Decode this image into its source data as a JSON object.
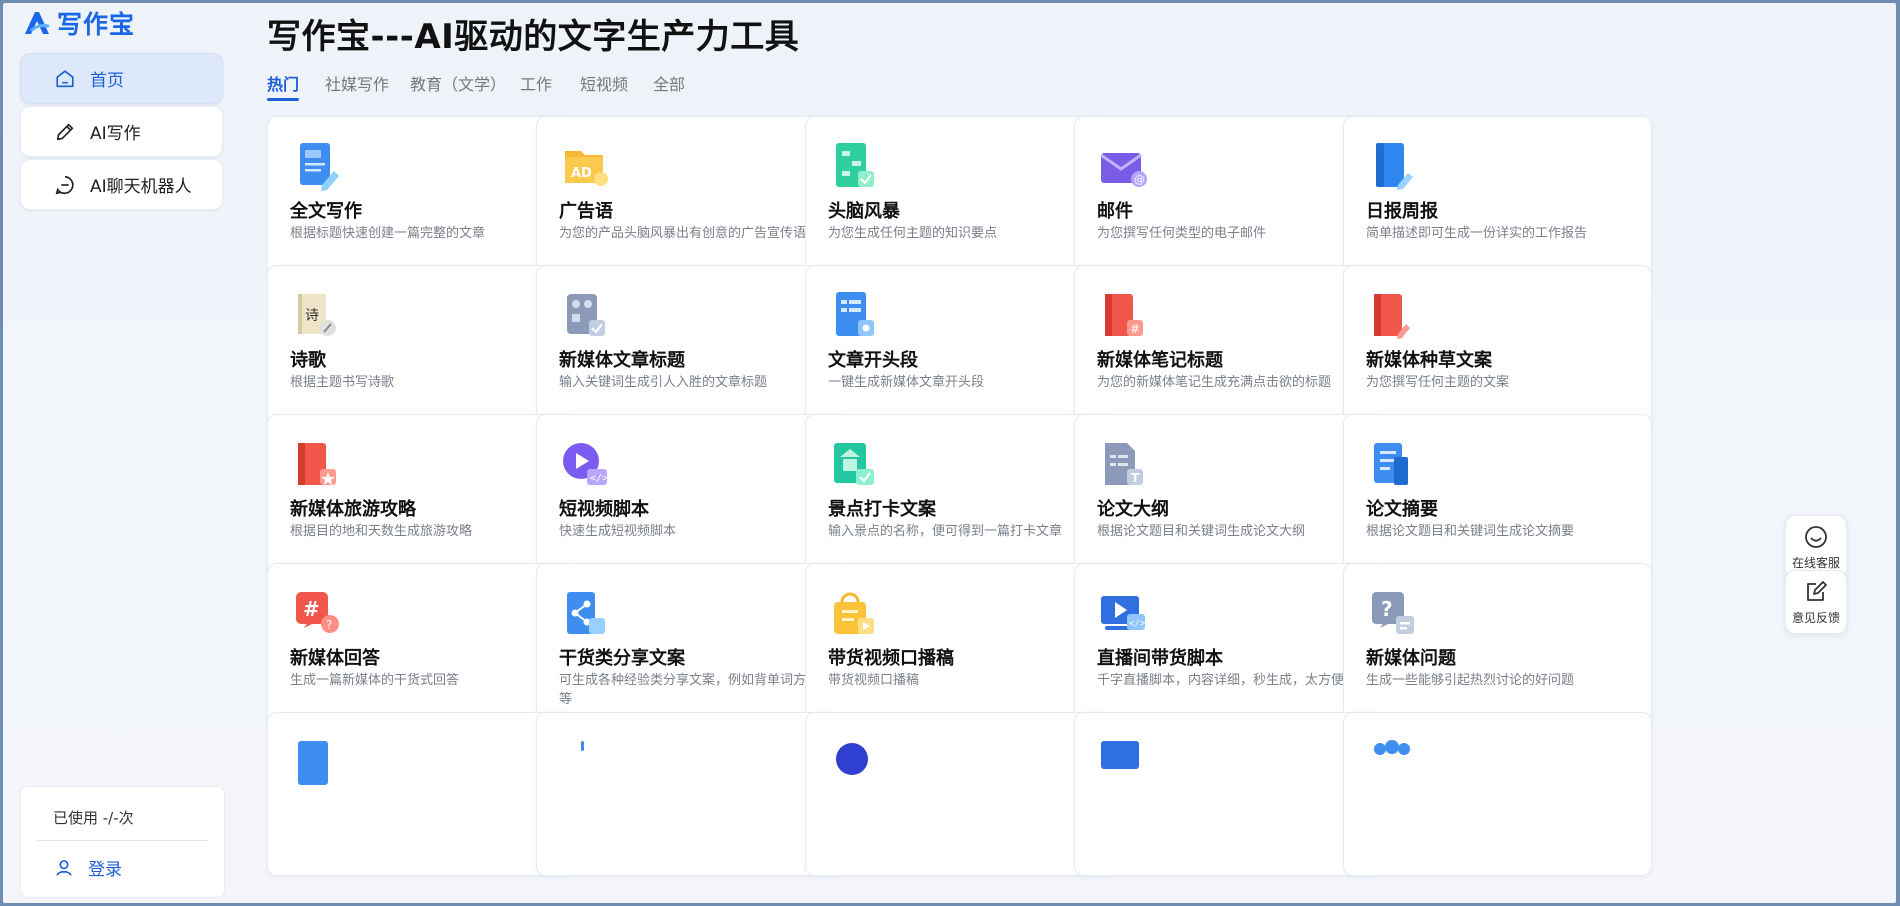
{
  "app": {
    "logo_text": "写作宝"
  },
  "sidebar": {
    "items": [
      {
        "label": "首页",
        "icon": "home-icon",
        "active": true
      },
      {
        "label": "AI写作",
        "icon": "pencil-icon",
        "active": false
      },
      {
        "label": "AI聊天机器人",
        "icon": "chat-icon",
        "active": false
      }
    ],
    "usage_text": "已使用 -/-次",
    "login_label": "登录"
  },
  "header": {
    "title": "写作宝---AI驱动的文字生产力工具"
  },
  "tabs": [
    {
      "label": "热门",
      "active": true
    },
    {
      "label": "社媒写作",
      "active": false
    },
    {
      "label": "教育（文学）",
      "active": false
    },
    {
      "label": "工作",
      "active": false
    },
    {
      "label": "短视频",
      "active": false
    },
    {
      "label": "全部",
      "active": false
    }
  ],
  "cards": [
    {
      "title": "全文写作",
      "desc": "根据标题快速创建一篇完整的文章",
      "icon": "document-write-icon"
    },
    {
      "title": "广告语",
      "desc": "为您的产品头脑风暴出有创意的广告宣传语",
      "icon": "ad-folder-icon"
    },
    {
      "title": "头脑风暴",
      "desc": "为您生成任何主题的知识要点",
      "icon": "mindmap-icon"
    },
    {
      "title": "邮件",
      "desc": "为您撰写任何类型的电子邮件",
      "icon": "email-icon"
    },
    {
      "title": "日报周报",
      "desc": "简单描述即可生成一份详实的工作报告",
      "icon": "report-book-icon"
    },
    {
      "title": "诗歌",
      "desc": "根据主题书写诗歌",
      "icon": "poem-scroll-icon",
      "icon_text": "诗"
    },
    {
      "title": "新媒体文章标题",
      "desc": "输入关键词生成引人入胜的文章标题",
      "icon": "article-title-icon"
    },
    {
      "title": "文章开头段",
      "desc": "一键生成新媒体文章开头段",
      "icon": "article-opening-icon"
    },
    {
      "title": "新媒体笔记标题",
      "desc": "为您的新媒体笔记生成充满点击欲的标题",
      "icon": "note-title-icon"
    },
    {
      "title": "新媒体种草文案",
      "desc": "为您撰写任何主题的文案",
      "icon": "recommend-copy-icon"
    },
    {
      "title": "新媒体旅游攻略",
      "desc": "根据目的地和天数生成旅游攻略",
      "icon": "travel-guide-icon"
    },
    {
      "title": "短视频脚本",
      "desc": "快速生成短视频脚本",
      "icon": "video-script-icon"
    },
    {
      "title": "景点打卡文案",
      "desc": "输入景点的名称，便可得到一篇打卡文章",
      "icon": "scenic-checkin-icon"
    },
    {
      "title": "论文大纲",
      "desc": "根据论文题目和关键词生成论文大纲",
      "icon": "thesis-outline-icon"
    },
    {
      "title": "论文摘要",
      "desc": "根据论文题目和关键词生成论文摘要",
      "icon": "thesis-abstract-icon"
    },
    {
      "title": "新媒体回答",
      "desc": "生成一篇新媒体的干货式回答",
      "icon": "hashtag-answer-icon"
    },
    {
      "title": "干货类分享文案",
      "desc": "可生成各种经验类分享文案，例如背单词方法等",
      "icon": "share-copy-icon"
    },
    {
      "title": "带货视频口播稿",
      "desc": "带货视频口播稿",
      "icon": "shopping-bag-video-icon"
    },
    {
      "title": "直播间带货脚本",
      "desc": "千字直播脚本，内容详细，秒生成，太方便啦!",
      "icon": "livestream-script-icon"
    },
    {
      "title": "新媒体问题",
      "desc": "生成一些能够引起热烈讨论的好问题",
      "icon": "question-icon"
    }
  ],
  "float": {
    "service_label": "在线客服",
    "feedback_label": "意见反馈"
  },
  "colors": {
    "accent": "#1e5fd8",
    "active_bg": "#dde8fb"
  }
}
